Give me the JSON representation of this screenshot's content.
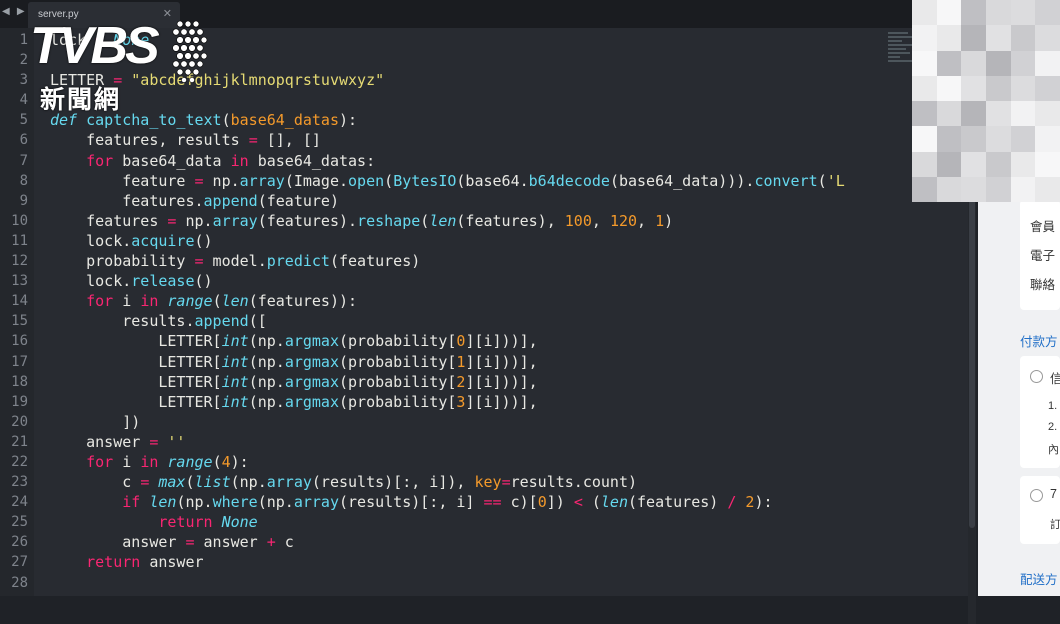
{
  "tab": {
    "title": "server.py",
    "close": "✕",
    "nav": "◀ ▶"
  },
  "watermark": {
    "main": "TVBS",
    "sub": "新聞網"
  },
  "code_lines": [
    {
      "n": "1",
      "html": "lock <span class=\"o\">=</span> <span class=\"kw\">None</span>"
    },
    {
      "n": "2",
      "html": ""
    },
    {
      "n": "3",
      "html": "LETTER <span class=\"o\">=</span> <span class=\"s\">\"abcdefghijklmnopqrstuvwxyz\"</span>"
    },
    {
      "n": "4",
      "html": ""
    },
    {
      "n": "5",
      "html": "<span class=\"kw\">def</span> <span class=\"f\">captcha_to_text</span>(<span class=\"n\">base64_datas</span>):"
    },
    {
      "n": "6",
      "html": "    features, results <span class=\"o\">=</span> [], []"
    },
    {
      "n": "7",
      "html": "    <span class=\"o\">for</span> base64_data <span class=\"o\">in</span> base64_datas:"
    },
    {
      "n": "8",
      "html": "        feature <span class=\"o\">=</span> np.<span class=\"f\">array</span>(Image.<span class=\"f\">open</span>(<span class=\"f\">BytesIO</span>(base64.<span class=\"f\">b64decode</span>(base64_data))).<span class=\"f\">convert</span>(<span class=\"s\">'L</span>"
    },
    {
      "n": "9",
      "html": "        features.<span class=\"f\">append</span>(feature)"
    },
    {
      "n": "10",
      "html": "    features <span class=\"o\">=</span> np.<span class=\"f\">array</span>(features).<span class=\"f\">reshape</span>(<span class=\"b\">len</span>(features), <span class=\"n\">100</span>, <span class=\"n\">120</span>, <span class=\"n\">1</span>)"
    },
    {
      "n": "11",
      "html": "    lock.<span class=\"f\">acquire</span>()"
    },
    {
      "n": "12",
      "html": "    probability <span class=\"o\">=</span> model.<span class=\"f\">predict</span>(features)"
    },
    {
      "n": "13",
      "html": "    lock.<span class=\"f\">release</span>()"
    },
    {
      "n": "14",
      "html": "    <span class=\"o\">for</span> i <span class=\"o\">in</span> <span class=\"b\">range</span>(<span class=\"b\">len</span>(features)):"
    },
    {
      "n": "15",
      "html": "        results.<span class=\"f\">append</span>(["
    },
    {
      "n": "16",
      "html": "            LETTER[<span class=\"b\">int</span>(np.<span class=\"f\">argmax</span>(probability[<span class=\"n\">0</span>][i]))],"
    },
    {
      "n": "17",
      "html": "            LETTER[<span class=\"b\">int</span>(np.<span class=\"f\">argmax</span>(probability[<span class=\"n\">1</span>][i]))],"
    },
    {
      "n": "18",
      "html": "            LETTER[<span class=\"b\">int</span>(np.<span class=\"f\">argmax</span>(probability[<span class=\"n\">2</span>][i]))],"
    },
    {
      "n": "19",
      "html": "            LETTER[<span class=\"b\">int</span>(np.<span class=\"f\">argmax</span>(probability[<span class=\"n\">3</span>][i]))],"
    },
    {
      "n": "20",
      "html": "        ])"
    },
    {
      "n": "21",
      "html": "    answer <span class=\"o\">=</span> <span class=\"s\">''</span>"
    },
    {
      "n": "22",
      "html": "    <span class=\"o\">for</span> i <span class=\"o\">in</span> <span class=\"b\">range</span>(<span class=\"n\">4</span>):"
    },
    {
      "n": "23",
      "html": "        c <span class=\"o\">=</span> <span class=\"b\">max</span>(<span class=\"b\">list</span>(np.<span class=\"f\">array</span>(results)[:, i]), <span class=\"n\">key</span><span class=\"o\">=</span>results.count)"
    },
    {
      "n": "24",
      "html": "        <span class=\"o\">if</span> <span class=\"b\">len</span>(np.<span class=\"f\">where</span>(np.<span class=\"f\">array</span>(results)[:, i] <span class=\"o\">==</span> c)[<span class=\"n\">0</span>]) <span class=\"o\">&lt;</span> (<span class=\"b\">len</span>(features) <span class=\"o\">/</span> <span class=\"n\">2</span>):"
    },
    {
      "n": "25",
      "html": "            <span class=\"o\">return</span> <span class=\"kw\">None</span>"
    },
    {
      "n": "26",
      "html": "        answer <span class=\"o\">=</span> answer <span class=\"o\">+</span> c"
    },
    {
      "n": "27",
      "html": "    <span class=\"o\">return</span> answer"
    },
    {
      "n": "28",
      "html": ""
    }
  ],
  "right_panel": {
    "member": "會員",
    "email": "電子",
    "contact": "聯絡",
    "payment_section": "付款方",
    "option1": "信",
    "sub1": "1.",
    "sub2": "2.",
    "sub3": "內",
    "option2": "7",
    "sub4": "訂",
    "delivery_section": "配送方"
  },
  "colors": {
    "keyword": "#66d9ef",
    "string": "#e6db74",
    "number": "#f49a2b",
    "operator": "#f92672",
    "background": "#282b31"
  }
}
